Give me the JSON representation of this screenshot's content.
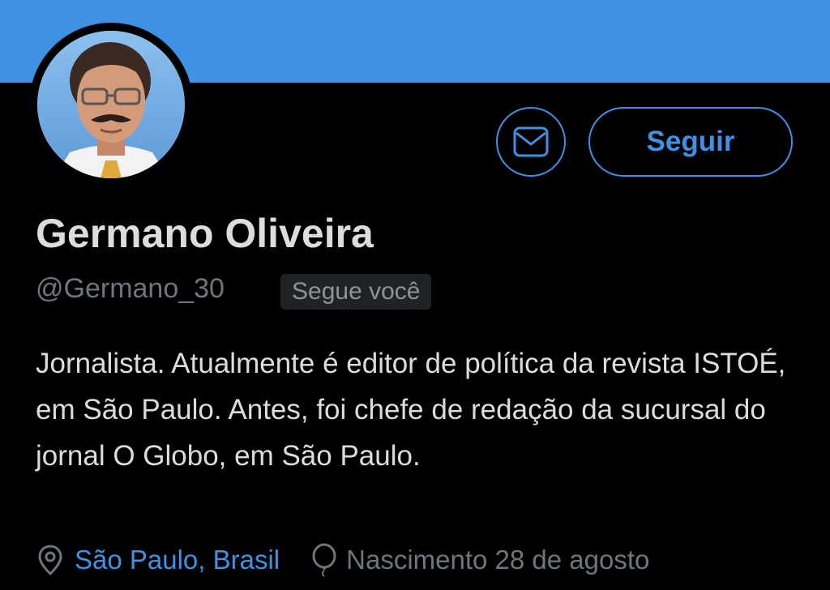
{
  "theme": {
    "accent": "#3f92e3",
    "background": "#000000",
    "text_primary": "#dcdcdc",
    "text_secondary": "#6e767d"
  },
  "header": {
    "banner_color": "#3f92e3"
  },
  "actions": {
    "message_icon": "envelope-icon",
    "follow_label": "Seguir"
  },
  "profile": {
    "name": "Germano Oliveira",
    "handle": "@Germano_30",
    "follows_you_badge": "Segue você",
    "bio": "Jornalista. Atualmente é editor de política da revista ISTOÉ, em São Paulo. Antes, foi chefe de redação da sucursal do jornal O Globo, em São Paulo.",
    "location_icon": "location-pin-icon",
    "location": "São Paulo, Brasil",
    "birthday_icon": "balloon-icon",
    "birthday": "Nascimento 28 de agosto"
  }
}
